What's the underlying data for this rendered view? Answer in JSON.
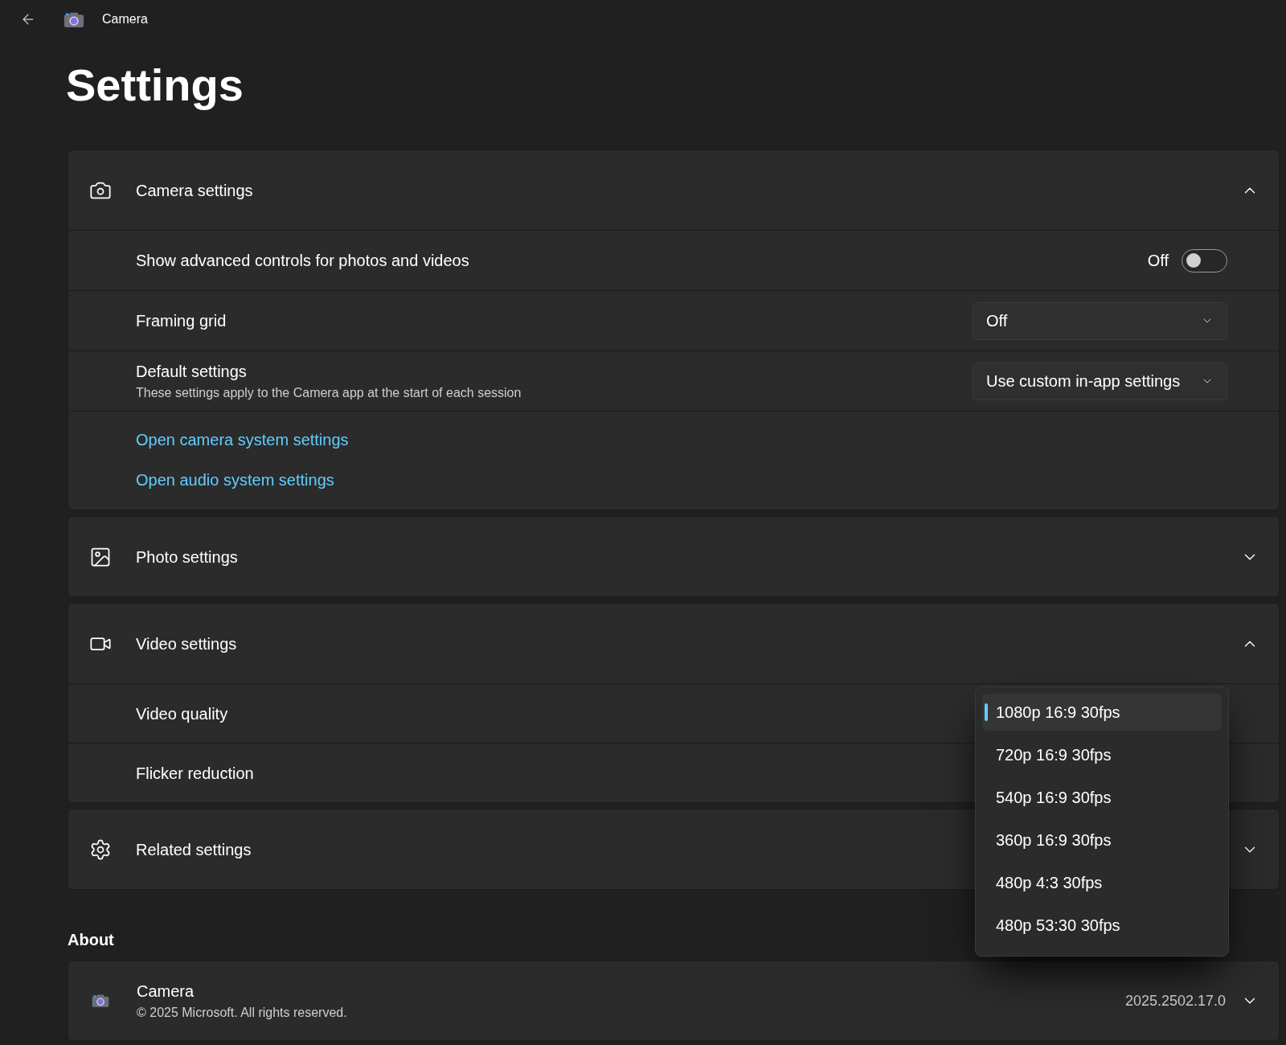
{
  "titlebar": {
    "title": "Camera"
  },
  "heading": "Settings",
  "sections": [
    {
      "title": "Camera settings",
      "expanded": true,
      "rows": [
        {
          "kind": "toggle",
          "label": "Show advanced controls for photos and videos",
          "state_text": "Off",
          "on": false
        },
        {
          "kind": "select",
          "label": "Framing grid",
          "value": "Off"
        },
        {
          "kind": "select",
          "label": "Default settings",
          "description": "These settings apply to the Camera app at the start of each session",
          "value": "Use custom in-app settings"
        },
        {
          "kind": "links",
          "links": [
            "Open camera system settings",
            "Open audio system settings"
          ]
        }
      ]
    },
    {
      "title": "Photo settings",
      "expanded": false
    },
    {
      "title": "Video settings",
      "expanded": true,
      "rows": [
        {
          "kind": "open-select",
          "label": "Video quality",
          "options": [
            {
              "label": "1080p 16:9 30fps",
              "selected": true
            },
            {
              "label": "720p 16:9 30fps",
              "selected": false
            },
            {
              "label": "540p 16:9 30fps",
              "selected": false
            },
            {
              "label": "360p 16:9 30fps",
              "selected": false
            },
            {
              "label": "480p 4:3 30fps",
              "selected": false
            },
            {
              "label": "480p 53:30 30fps",
              "selected": false
            }
          ]
        },
        {
          "kind": "text",
          "label": "Flicker reduction"
        }
      ]
    },
    {
      "title": "Related settings",
      "expanded": false
    }
  ],
  "about": {
    "heading": "About",
    "app_name": "Camera",
    "copyright": "© 2025 Microsoft. All rights reserved.",
    "version": "2025.2502.17.0",
    "expanded": false
  }
}
